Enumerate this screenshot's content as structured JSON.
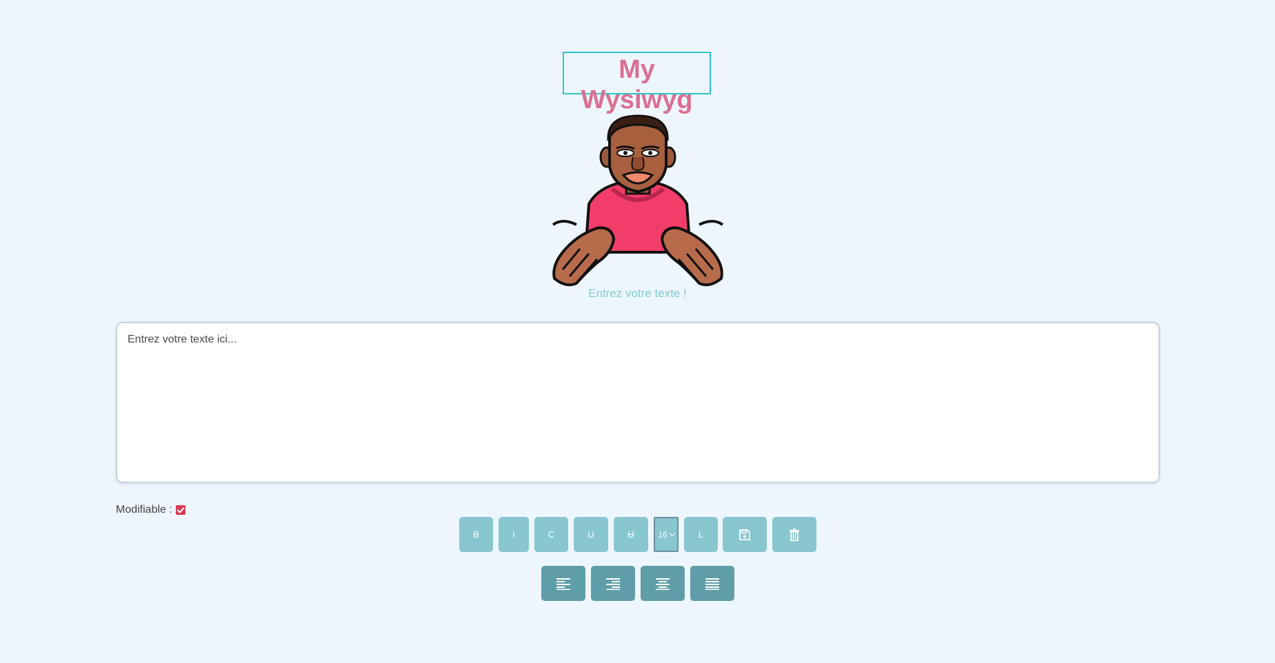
{
  "header": {
    "title": "My Wysiwyg"
  },
  "subtitle": "Entrez votre texte !",
  "editor": {
    "placeholder": "Entrez votre texte ici..."
  },
  "modifiable": {
    "label": "Modifiable :",
    "checked": true
  },
  "toolbar": {
    "bold_label": "B",
    "italic_label": "I",
    "color_label": "C",
    "underline_label": "U",
    "strike_label": "U",
    "font_size": "16",
    "link_label": "L",
    "save_icon": "save-icon",
    "delete_icon": "trash-icon"
  },
  "alignment": {
    "icons": [
      "align-left-icon",
      "align-right-icon",
      "align-center-icon",
      "align-justify-icon"
    ]
  },
  "colors": {
    "background": "#eef6fd",
    "title": "#db7093",
    "title_border": "#2ec4c9",
    "toolbar_button": "#88c6d0",
    "align_button": "#5f9ea8",
    "checkbox": "#d63a55"
  }
}
